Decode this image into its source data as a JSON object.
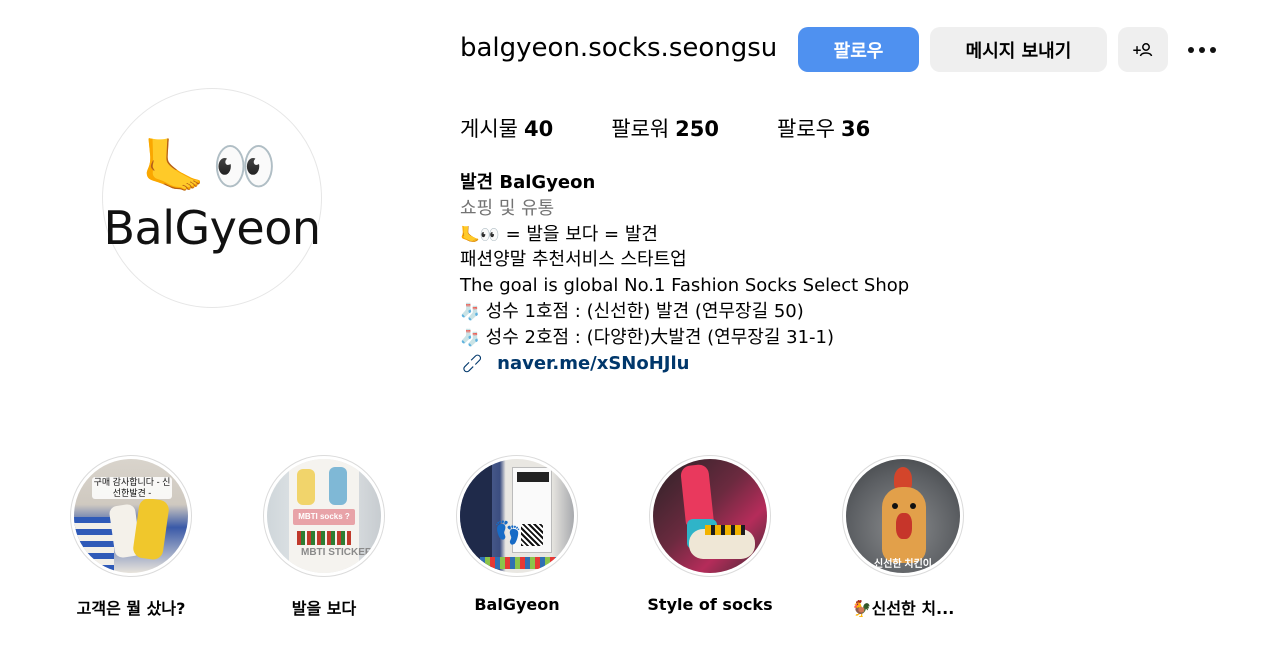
{
  "profile": {
    "avatar_emoji": "🦶👀",
    "avatar_text": "BalGyeon",
    "username": "balgyeon.socks.seongsu",
    "follow_button": "팔로우",
    "message_button": "메시지 보내기",
    "suggest_button": "+옹",
    "more_icon": "more-horizontal-icon"
  },
  "stats": {
    "posts_label": "게시물",
    "posts_count": "40",
    "followers_label": "팔로워",
    "followers_count": "250",
    "following_label": "팔로우",
    "following_count": "36"
  },
  "bio": {
    "name": "발견 BalGyeon",
    "category": "쇼핑 및 유통",
    "line1_emoji": "🦶👀",
    "line1_text": " = 발을 보다 = 발견",
    "line2": "패션양말 추천서비스 스타트업",
    "line3": "The goal is global No.1 Fashion Socks Select Shop",
    "line4_emoji": "🧦",
    "line4_text": "성수 1호점 : (신선한) 발견 (연무장길 50)",
    "line5_emoji": "🧦",
    "line5_text": "성수 2호점 : (다양한)大발견 (연무장길 31-1)",
    "link_icon": "link-icon",
    "link": "naver.me/xSNoHJlu"
  },
  "highlights": [
    {
      "label": "고객은 뭘 샀나?",
      "caption": "구매 감사합니다 - 신선한발견 -"
    },
    {
      "label": "발을 보다",
      "caption": "MBTI socks ?",
      "caption2": "MBTI STICKER"
    },
    {
      "label": "BalGyeon"
    },
    {
      "label": "Style of socks"
    },
    {
      "label": "🐓신선한 치...",
      "caption": "신선한 치킨이"
    }
  ]
}
